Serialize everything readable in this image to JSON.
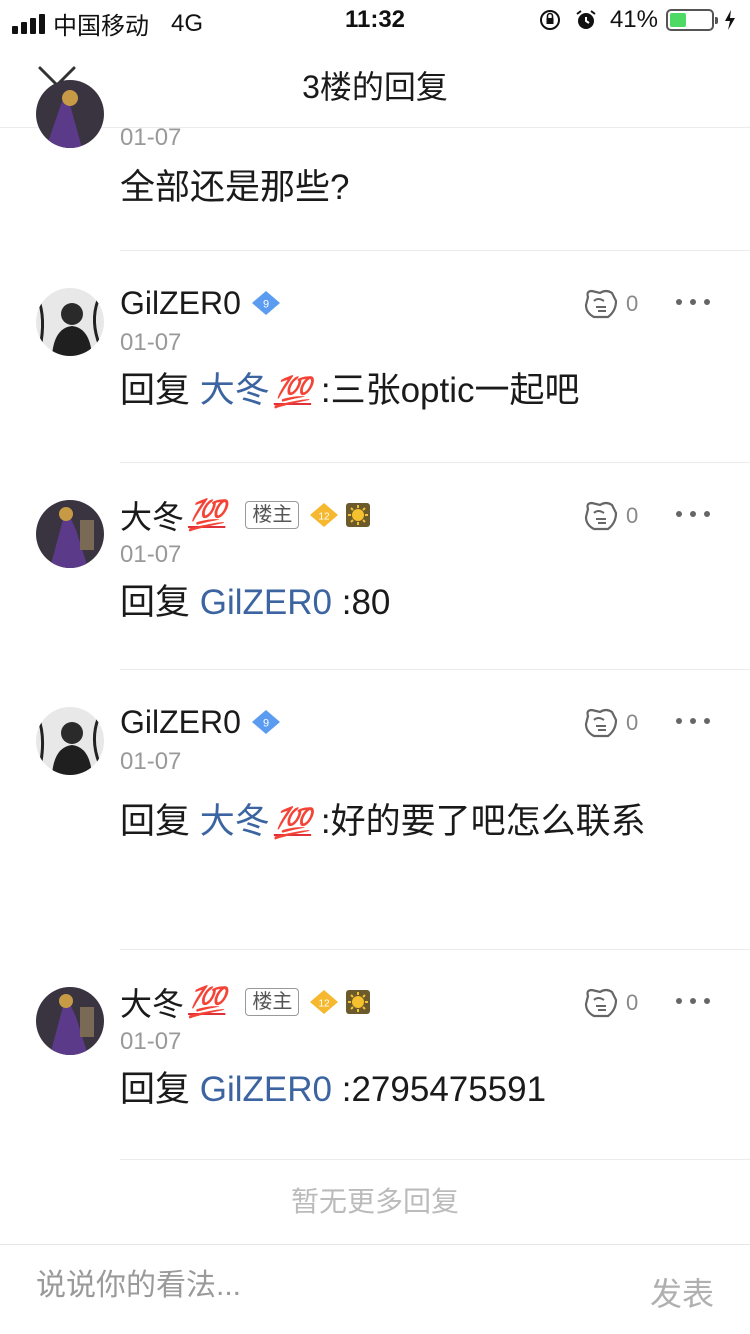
{
  "status_bar": {
    "carrier": "中国移动",
    "network": "4G",
    "time": "11:32",
    "battery": "41%",
    "battery_level": 0.41,
    "battery_color": "#4cd964"
  },
  "nav": {
    "title": "3楼的回复",
    "close_icon": "close-icon"
  },
  "replies": [
    {
      "user": "",
      "date": "01-07",
      "reply_prefix": "",
      "reply_target": "",
      "text": "全部还是那些?",
      "show_header": false
    },
    {
      "user": "GilZER0",
      "level": "9",
      "date": "01-07",
      "likes": "0",
      "reply_prefix": "回复",
      "reply_target": "大冬",
      "text": ":三张optic一起吧"
    },
    {
      "user": "大冬",
      "owner_tag": "楼主",
      "level": "12",
      "date": "01-07",
      "likes": "0",
      "reply_prefix": "回复",
      "reply_target": "GilZER0",
      "text": ":80"
    },
    {
      "user": "GilZER0",
      "level": "9",
      "date": "01-07",
      "likes": "0",
      "reply_prefix": "回复",
      "reply_target": "大冬",
      "text": ":好的要了吧怎么联系"
    },
    {
      "user": "大冬",
      "owner_tag": "楼主",
      "level": "12",
      "date": "01-07",
      "likes": "0",
      "reply_prefix": "回复",
      "reply_target": "GilZER0",
      "text": ":2795475591"
    }
  ],
  "emoji_100": "💯",
  "no_more": "暂无更多回复",
  "bottom": {
    "placeholder": "说说你的看法...",
    "send": "发表"
  },
  "colors": {
    "link": "#3b64a1",
    "badge_blue": "#5b9cf0",
    "badge_gold": "#f5b82e"
  }
}
